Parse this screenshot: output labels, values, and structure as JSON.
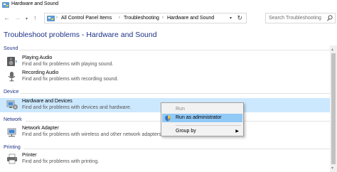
{
  "window": {
    "title": "Hardware and Sound"
  },
  "address_bar": {
    "breadcrumbs": [
      "All Control Panel Items",
      "Troubleshooting",
      "Hardware and Sound"
    ]
  },
  "search": {
    "placeholder": "Search Troubleshooting"
  },
  "page_title": "Troubleshoot problems - Hardware and Sound",
  "sections": {
    "sound": {
      "label": "Sound",
      "items": [
        {
          "name": "Playing Audio",
          "description": "Find and fix problems with playing sound.",
          "icon": "speaker-icon"
        },
        {
          "name": "Recording Audio",
          "description": "Find and fix problems with recording sound.",
          "icon": "microphone-icon"
        }
      ]
    },
    "device": {
      "label": "Device",
      "items": [
        {
          "name": "Hardware and Devices",
          "description": "Find and fix problems with devices and hardware.",
          "icon": "hardware-icon",
          "selected": true
        }
      ]
    },
    "network": {
      "label": "Network",
      "items": [
        {
          "name": "Network Adapter",
          "description": "Find and fix problems with wireless and other network adapters.",
          "icon": "network-adapter-icon"
        }
      ]
    },
    "printing": {
      "label": "Printing",
      "items": [
        {
          "name": "Printer",
          "description": "Find and fix problems with printing.",
          "icon": "printer-icon"
        }
      ]
    }
  },
  "context_menu": {
    "run": "Run",
    "run_as_admin": "Run as administrator",
    "group_by": "Group by"
  },
  "colors": {
    "heading_blue": "#1e3287",
    "selection": "#cce8ff",
    "menu_highlight": "#91c9f7"
  }
}
